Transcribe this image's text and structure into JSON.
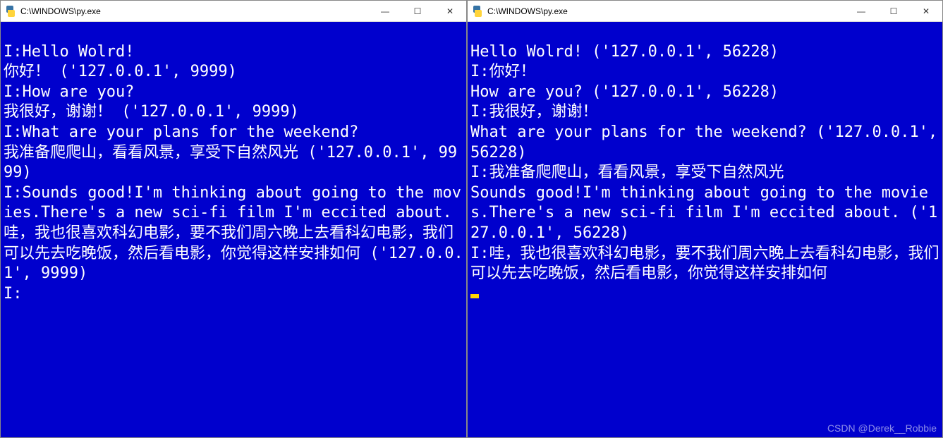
{
  "left_window": {
    "title": "C:\\WINDOWS\\py.exe",
    "lines": [
      "I:Hello Wolrd!",
      "你好！ ('127.0.0.1', 9999)",
      "I:How are you?",
      "我很好，谢谢！ ('127.0.0.1', 9999)",
      "I:What are your plans for the weekend?",
      "我准备爬爬山，看看风景，享受下自然风光 ('127.0.0.1', 9999)",
      "I:Sounds good!I'm thinking about going to the movies.There's a new sci-fi film I'm eccited about.",
      "哇，我也很喜欢科幻电影，要不我们周六晚上去看科幻电影，我们可以先去吃晚饭，然后看电影，你觉得这样安排如何 ('127.0.0.1', 9999)",
      "I:"
    ]
  },
  "right_window": {
    "title": "C:\\WINDOWS\\py.exe",
    "lines": [
      "Hello Wolrd! ('127.0.0.1', 56228)",
      "I:你好！",
      "How are you? ('127.0.0.1', 56228)",
      "I:我很好，谢谢！",
      "What are your plans for the weekend? ('127.0.0.1', 56228)",
      "I:我准备爬爬山，看看风景，享受下自然风光",
      "Sounds good!I'm thinking about going to the movies.There's a new sci-fi film I'm eccited about. ('127.0.0.1', 56228)",
      "I:哇，我也很喜欢科幻电影，要不我们周六晚上去看科幻电影，我们可以先去吃晚饭，然后看电影，你觉得这样安排如何"
    ]
  },
  "watermark": "CSDN @Derek__Robbie",
  "controls": {
    "minimize": "—",
    "maximize": "☐",
    "close": "✕"
  }
}
